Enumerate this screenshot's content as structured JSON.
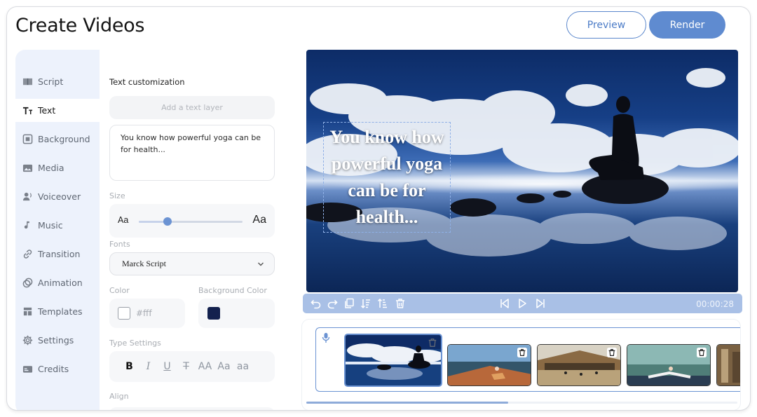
{
  "header": {
    "title": "Create Videos",
    "preview_label": "Preview",
    "render_label": "Render"
  },
  "sidebar": {
    "items": [
      {
        "label": "Script",
        "icon": "book-icon"
      },
      {
        "label": "Text",
        "icon": "text-icon",
        "active": true
      },
      {
        "label": "Background",
        "icon": "background-icon"
      },
      {
        "label": "Media",
        "icon": "media-icon"
      },
      {
        "label": "Voiceover",
        "icon": "voiceover-icon"
      },
      {
        "label": "Music",
        "icon": "music-note-icon"
      },
      {
        "label": "Transition",
        "icon": "link-icon"
      },
      {
        "label": "Animation",
        "icon": "animation-icon"
      },
      {
        "label": "Templates",
        "icon": "templates-icon"
      },
      {
        "label": "Settings",
        "icon": "gear-icon"
      },
      {
        "label": "Credits",
        "icon": "credits-icon"
      }
    ]
  },
  "editor": {
    "section_title": "Text customization",
    "add_layer_placeholder": "Add a text layer",
    "text_value": "You know how powerful yoga can be for health...",
    "size_label": "Size",
    "size_small": "Aa",
    "size_large": "Aa",
    "size_level": 0.28,
    "fonts_label": "Fonts",
    "font_value": "Marck Script",
    "color_label": "Color",
    "color_value": "#fff",
    "color_swatch": "#ffffff",
    "bg_color_label": "Background Color",
    "bg_color_swatch": "#13214e",
    "type_settings_label": "Type Settings",
    "type_buttons": [
      "B",
      "I",
      "U",
      "T",
      "AA",
      "Aa",
      "aa"
    ],
    "align_label": "Align"
  },
  "preview": {
    "overlay_text": "You know how powerful yoga can be for health..."
  },
  "controls": {
    "time": "00:00:28"
  },
  "timeline": {
    "clips": [
      {
        "name": "clip-1",
        "selected": true
      },
      {
        "name": "clip-2",
        "selected": false
      },
      {
        "name": "clip-3",
        "selected": false
      },
      {
        "name": "clip-4",
        "selected": false
      },
      {
        "name": "clip-5",
        "selected": false
      }
    ]
  },
  "colors": {
    "accent": "#5f8bd0",
    "nav_bg": "#edf2fc",
    "controls_bg": "#a9c0e6"
  }
}
